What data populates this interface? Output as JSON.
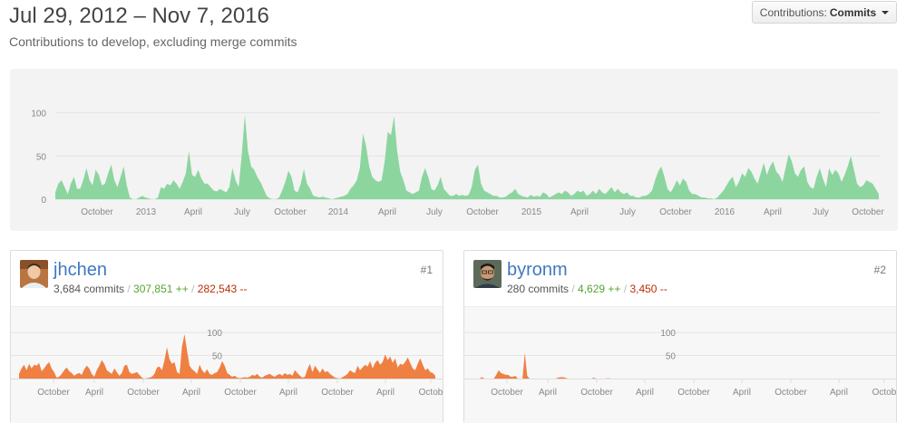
{
  "header": {
    "title": "Jul 29, 2012 – Nov 7, 2016",
    "subtitle": "Contributions to develop, excluding merge commits",
    "contrib_prefix": "Contributions:",
    "contrib_value": "Commits"
  },
  "colors": {
    "main_fill": "#8cd59f",
    "user_fill": "#f07f42",
    "link": "#4078c0",
    "additions": "#55a532",
    "deletions": "#bd2c00"
  },
  "chart_data": [
    {
      "type": "area",
      "y_ticks": [
        "100",
        "50",
        "0"
      ],
      "ylim": [
        0,
        110
      ],
      "x_ticks": [
        "October",
        "2013",
        "April",
        "July",
        "October",
        "2014",
        "April",
        "July",
        "October",
        "2015",
        "April",
        "July",
        "October",
        "2016",
        "April",
        "July",
        "October"
      ],
      "values": [
        8,
        18,
        22,
        14,
        6,
        18,
        26,
        12,
        12,
        22,
        36,
        22,
        16,
        34,
        28,
        16,
        18,
        30,
        40,
        22,
        14,
        26,
        38,
        16,
        2,
        0,
        0,
        2,
        4,
        2,
        1,
        0,
        0,
        2,
        14,
        12,
        18,
        16,
        22,
        18,
        12,
        20,
        30,
        56,
        28,
        26,
        34,
        24,
        18,
        18,
        14,
        10,
        9,
        12,
        10,
        8,
        14,
        36,
        22,
        14,
        52,
        98,
        56,
        38,
        34,
        26,
        20,
        12,
        4,
        1,
        0,
        0,
        2,
        10,
        20,
        33,
        26,
        10,
        8,
        18,
        35,
        18,
        12,
        4,
        3,
        2,
        3,
        2,
        1,
        0,
        1,
        2,
        3,
        4,
        6,
        12,
        16,
        22,
        36,
        76,
        62,
        38,
        26,
        22,
        20,
        22,
        44,
        78,
        74,
        96,
        56,
        32,
        22,
        10,
        8,
        6,
        8,
        10,
        26,
        36,
        26,
        12,
        10,
        16,
        26,
        12,
        8,
        4,
        4,
        6,
        4,
        5,
        4,
        5,
        14,
        34,
        40,
        18,
        10,
        8,
        6,
        4,
        4,
        2,
        2,
        3,
        6,
        8,
        12,
        6,
        4,
        3,
        2,
        5,
        3,
        4,
        3,
        8,
        6,
        2,
        4,
        6,
        8,
        6,
        10,
        8,
        4,
        6,
        10,
        8,
        10,
        4,
        6,
        10,
        6,
        12,
        8,
        6,
        10,
        14,
        8,
        12,
        8,
        6,
        8,
        4,
        4,
        2,
        2,
        4,
        4,
        6,
        10,
        22,
        32,
        38,
        26,
        12,
        8,
        14,
        22,
        16,
        24,
        20,
        10,
        6,
        6,
        4,
        2,
        2,
        1,
        1,
        0,
        2,
        6,
        10,
        16,
        22,
        26,
        14,
        20,
        30,
        26,
        36,
        32,
        24,
        18,
        30,
        42,
        28,
        38,
        44,
        32,
        28,
        20,
        36,
        52,
        44,
        30,
        26,
        34,
        38,
        20,
        14,
        12,
        26,
        36,
        24,
        14,
        36,
        28,
        34,
        30,
        20,
        28,
        38,
        50,
        34,
        18,
        14,
        16,
        22,
        20,
        18,
        12,
        6
      ]
    },
    {
      "type": "area",
      "y_ticks": [
        "100",
        "50"
      ],
      "ylim": [
        0,
        110
      ],
      "x_ticks": [
        "October",
        "April",
        "October",
        "April",
        "October",
        "April",
        "October",
        "April",
        "Octob"
      ],
      "values": [
        10,
        22,
        30,
        18,
        32,
        22,
        30,
        28,
        34,
        16,
        22,
        30,
        36,
        22,
        14,
        2,
        4,
        10,
        18,
        24,
        16,
        12,
        6,
        10,
        12,
        8,
        20,
        28,
        22,
        10,
        4,
        18,
        28,
        40,
        32,
        18,
        14,
        10,
        22,
        14,
        6,
        12,
        28,
        30,
        14,
        10,
        12,
        14,
        8,
        2,
        0,
        1,
        2,
        4,
        10,
        24,
        26,
        18,
        40,
        68,
        42,
        32,
        36,
        14,
        10,
        70,
        96,
        60,
        28,
        20,
        16,
        10,
        30,
        18,
        12,
        20,
        10,
        8,
        12,
        14,
        24,
        38,
        28,
        12,
        8,
        4,
        6,
        2,
        1,
        2,
        3,
        2,
        4,
        8,
        6,
        10,
        4,
        2,
        6,
        8,
        10,
        6,
        4,
        8,
        10,
        6,
        12,
        8,
        10,
        6,
        18,
        12,
        6,
        2,
        4,
        20,
        32,
        14,
        28,
        20,
        12,
        22,
        14,
        16,
        10,
        6,
        2,
        1,
        0,
        3,
        6,
        10,
        18,
        14,
        12,
        28,
        18,
        24,
        30,
        26,
        38,
        22,
        34,
        40,
        30,
        36,
        52,
        40,
        48,
        34,
        44,
        24,
        32,
        30,
        36,
        46,
        34,
        22,
        18,
        32,
        44,
        30,
        18,
        22,
        14,
        12,
        6
      ]
    },
    {
      "type": "area",
      "y_ticks": [
        "100",
        "50"
      ],
      "ylim": [
        0,
        110
      ],
      "x_ticks": [
        "October",
        "April",
        "October",
        "April",
        "October",
        "April",
        "October",
        "April",
        "Octob"
      ],
      "values": [
        0,
        0,
        0,
        0,
        0,
        0,
        0,
        0,
        0,
        0,
        0,
        0,
        0,
        0,
        0,
        0,
        0,
        0,
        0,
        0,
        0,
        0,
        0,
        0,
        0,
        0,
        0,
        0,
        0,
        0,
        0,
        0,
        0,
        0,
        0,
        0,
        0,
        0,
        0,
        0,
        0,
        0,
        0,
        0,
        0,
        0,
        0,
        0,
        0,
        0,
        0,
        0,
        0,
        0,
        0,
        0,
        0,
        0,
        0,
        0,
        0,
        0,
        0,
        0,
        0,
        0,
        0,
        0,
        0,
        0,
        0,
        0,
        0,
        0,
        0,
        0,
        0,
        0,
        0,
        0,
        0,
        0,
        0,
        0,
        0,
        0,
        0,
        0,
        0,
        0,
        0,
        0,
        0,
        0,
        0,
        0,
        0,
        0,
        0,
        0,
        0,
        0,
        0,
        0,
        0,
        0,
        0,
        0,
        0,
        0,
        0,
        0,
        0,
        0,
        0,
        0,
        0,
        0,
        0,
        0,
        0,
        0,
        0,
        0,
        0,
        0,
        0,
        0,
        0,
        0,
        0,
        0,
        0,
        0,
        0,
        0,
        0,
        0,
        0,
        0,
        0,
        0,
        0,
        0,
        0,
        0,
        0,
        0,
        0,
        0,
        0,
        0,
        0,
        0,
        0,
        0,
        0,
        0,
        0,
        0,
        0,
        0,
        0,
        0,
        0,
        0,
        0,
        0,
        0,
        0,
        0,
        0,
        0,
        0,
        0,
        0
      ]
    }
  ],
  "contributors": [
    {
      "rank": "#1",
      "name": "jhchen",
      "commits": "3,684 commits",
      "additions": "307,851 ++",
      "deletions": "282,543 --"
    },
    {
      "rank": "#2",
      "name": "byronm",
      "commits": "280 commits",
      "additions": "4,629 ++",
      "deletions": "3,450 --"
    }
  ]
}
